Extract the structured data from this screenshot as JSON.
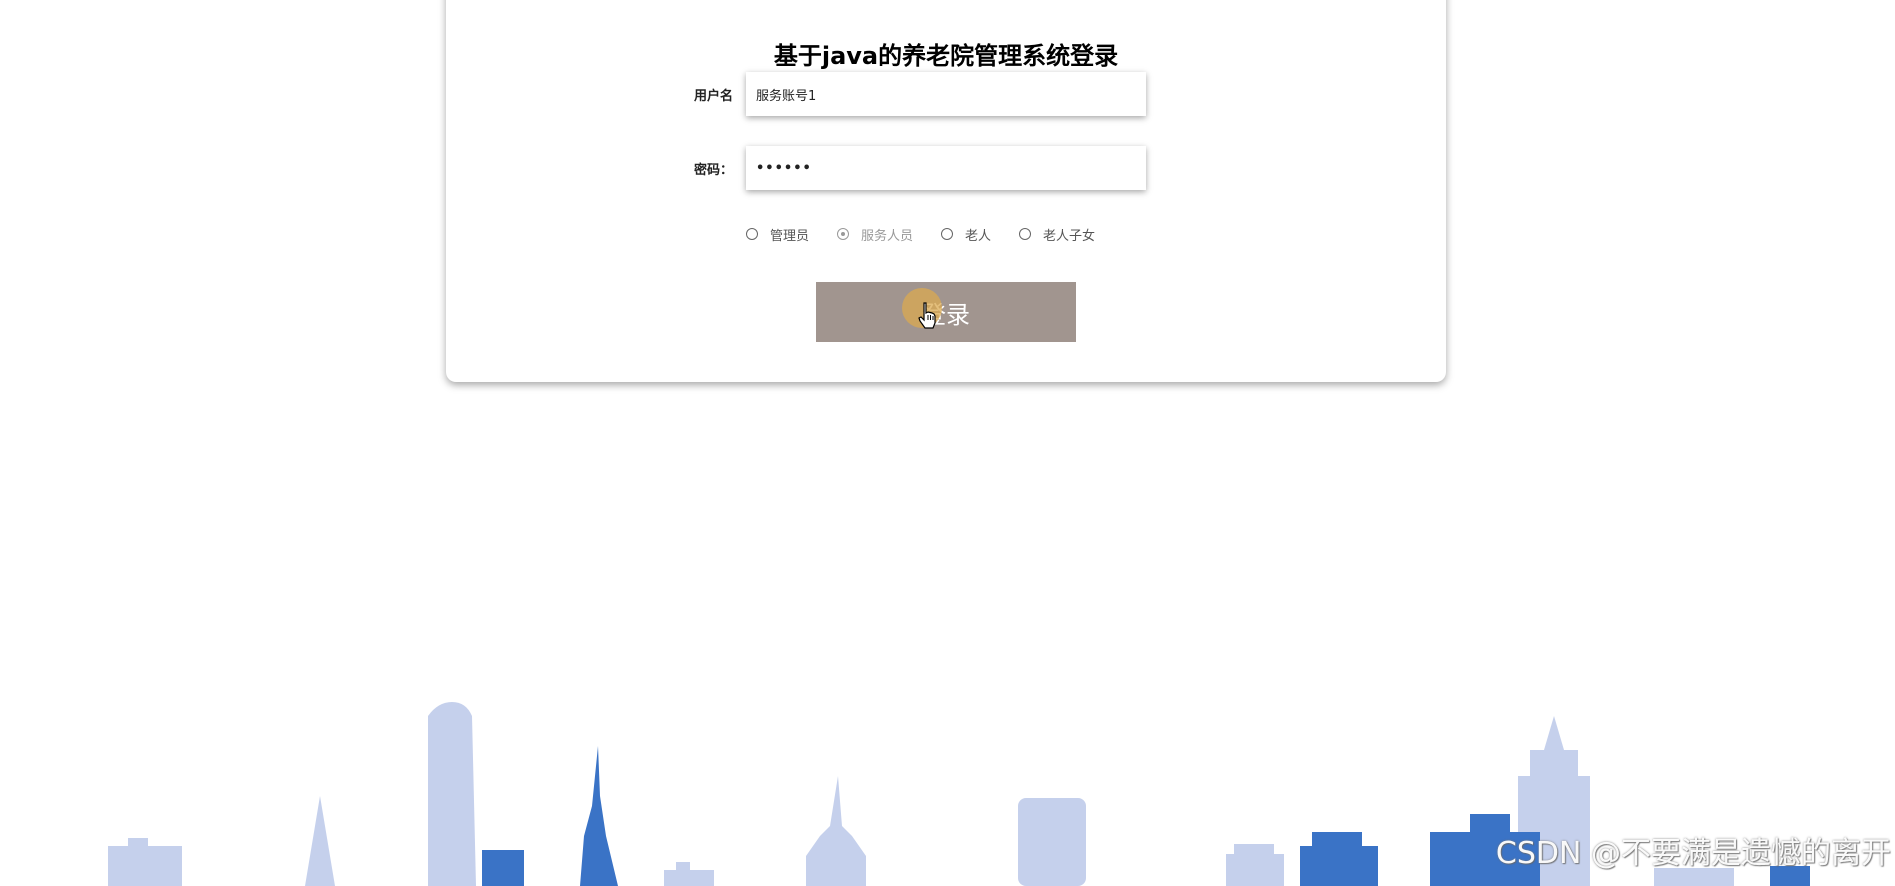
{
  "login": {
    "title": "基于java的养老院管理系统登录",
    "username_label": "用户名",
    "username_value": "服务账号1",
    "password_label": "密码：",
    "password_value": "••••••",
    "roles": [
      {
        "label": "管理员",
        "checked": false
      },
      {
        "label": "服务人员",
        "checked": true
      },
      {
        "label": "老人",
        "checked": false
      },
      {
        "label": "老人子女",
        "checked": false
      }
    ],
    "submit_label": "登录"
  },
  "watermark": "CSDN @不要满是遗憾的离开",
  "colors": {
    "button": "#a1958f",
    "skyline_light": "#c5d0ec",
    "skyline_dark": "#3a73c6"
  }
}
